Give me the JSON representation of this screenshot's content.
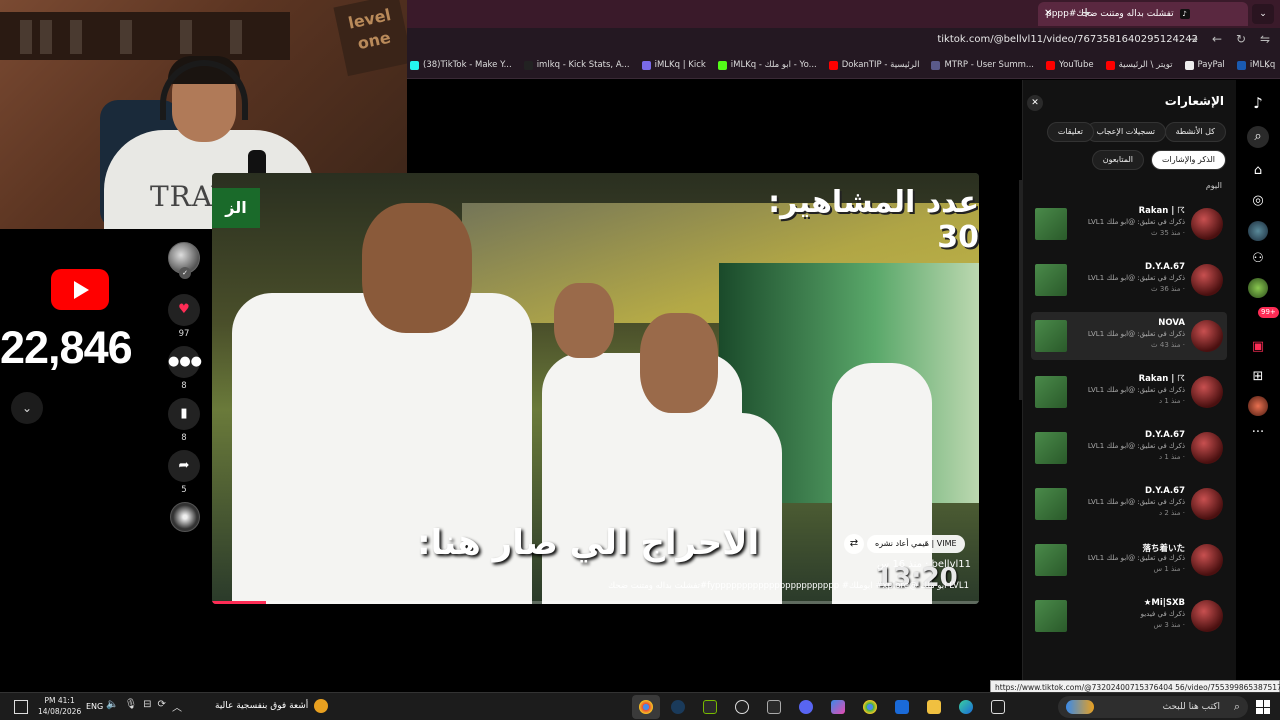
{
  "browser": {
    "tab_title": "تفشلت بداله ومتنت ضحك#pppp",
    "url": "tiktok.com/@bellvl11/video/7673581640295124242",
    "bookmarks": [
      {
        "label": "(38)TikTok - Make Y...",
        "color": "#25f4ee"
      },
      {
        "label": "imlkq - Kick Stats, A...",
        "color": "#222"
      },
      {
        "label": "iMLKq | Kick",
        "color": "#7a6ae8"
      },
      {
        "label": "iMLKq - ابو ملك - Yo...",
        "color": "#53fc18"
      },
      {
        "label": "DokanTIP - الرئيسية",
        "color": "#ff0000"
      },
      {
        "label": "MTRP - User Summ...",
        "color": "#5a5a8a"
      },
      {
        "label": "YouTube",
        "color": "#ff0000"
      },
      {
        "label": "تويتر \\ الرئيسية",
        "color": "#ff0000"
      },
      {
        "label": "PayPal",
        "color": "#eee"
      },
      {
        "label": "iMLKq",
        "color": "#1a5ab0"
      }
    ]
  },
  "webcam": {
    "shirt_text": "TRAVEL",
    "sign_text": "level one"
  },
  "subscribers": {
    "count": "22,846"
  },
  "actions": {
    "likes": "97",
    "comments": "8",
    "saves": "8",
    "shares": "5"
  },
  "video": {
    "title_overlay": "عدد المشاهير: 30",
    "subtitle_overlay": "الاحراج الي صار هنا:",
    "time_overlay": "13:20",
    "badge_text": "الز",
    "repost_text": "VIME | هَيمي أعاد نشره",
    "author": "bellvl11 · منذ 16 س",
    "caption": "تفشلت بداله ومتنت ضحك#fyppppppppppppppppppppppp #ابوملك #xplore@ ابو ملك LVL1",
    "progress": 0.07
  },
  "notifications_panel": {
    "title": "الإشعارات",
    "tabs": [
      "كل الأنشطة",
      "تسجيلات الإعجاب",
      "تعليقات",
      "المتابعون",
      "الذكر والإشارات"
    ],
    "active_tab": "الذكر والإشارات",
    "section_label": "اليوم",
    "items": [
      {
        "name": "Rakan | ☈",
        "message": "ذكرك في تعليق: @ابو ملك LVL1",
        "time": "· منذ 35 ث",
        "highlighted": false
      },
      {
        "name": "D.Y.A.67",
        "message": "ذكرك في تعليق: @ابو ملك LVL1",
        "time": "· منذ 36 ث",
        "highlighted": false
      },
      {
        "name": "NOVA",
        "message": "ذكرك في تعليق: @ابو ملك LVL1",
        "time": "· منذ 43 ث",
        "highlighted": true
      },
      {
        "name": "Rakan | ☈",
        "message": "ذكرك في تعليق: @ابو ملك LVL1",
        "time": "· منذ 1 د",
        "highlighted": false
      },
      {
        "name": "D.Y.A.67",
        "message": "ذكرك في تعليق: @ابو ملك LVL1",
        "time": "· منذ 1 د",
        "highlighted": false
      },
      {
        "name": "D.Y.A.67",
        "message": "ذكرك في تعليق: @ابو ملك LVL1",
        "time": "· منذ 2 د",
        "highlighted": false
      },
      {
        "name": "落ち着いた",
        "message": "ذكرك في تعليق: @ابو ملك LVL1",
        "time": "· منذ 1 س",
        "highlighted": false
      },
      {
        "name": "★Mi|SXB",
        "message": "ذكرك في فيديو",
        "time": "· منذ 3 س",
        "highlighted": false
      }
    ]
  },
  "rail": {
    "badge": "99+"
  },
  "status_url": "https://www.tiktok.com/@73202400715376404 56/video/7553998653875178773",
  "taskbar": {
    "time": "PM 41:1",
    "date": "14/08/2026",
    "language": "ENG",
    "weather_text": "أشعة فوق بنفسجية عالية",
    "search_placeholder": "اكتب هنا للبحث"
  }
}
